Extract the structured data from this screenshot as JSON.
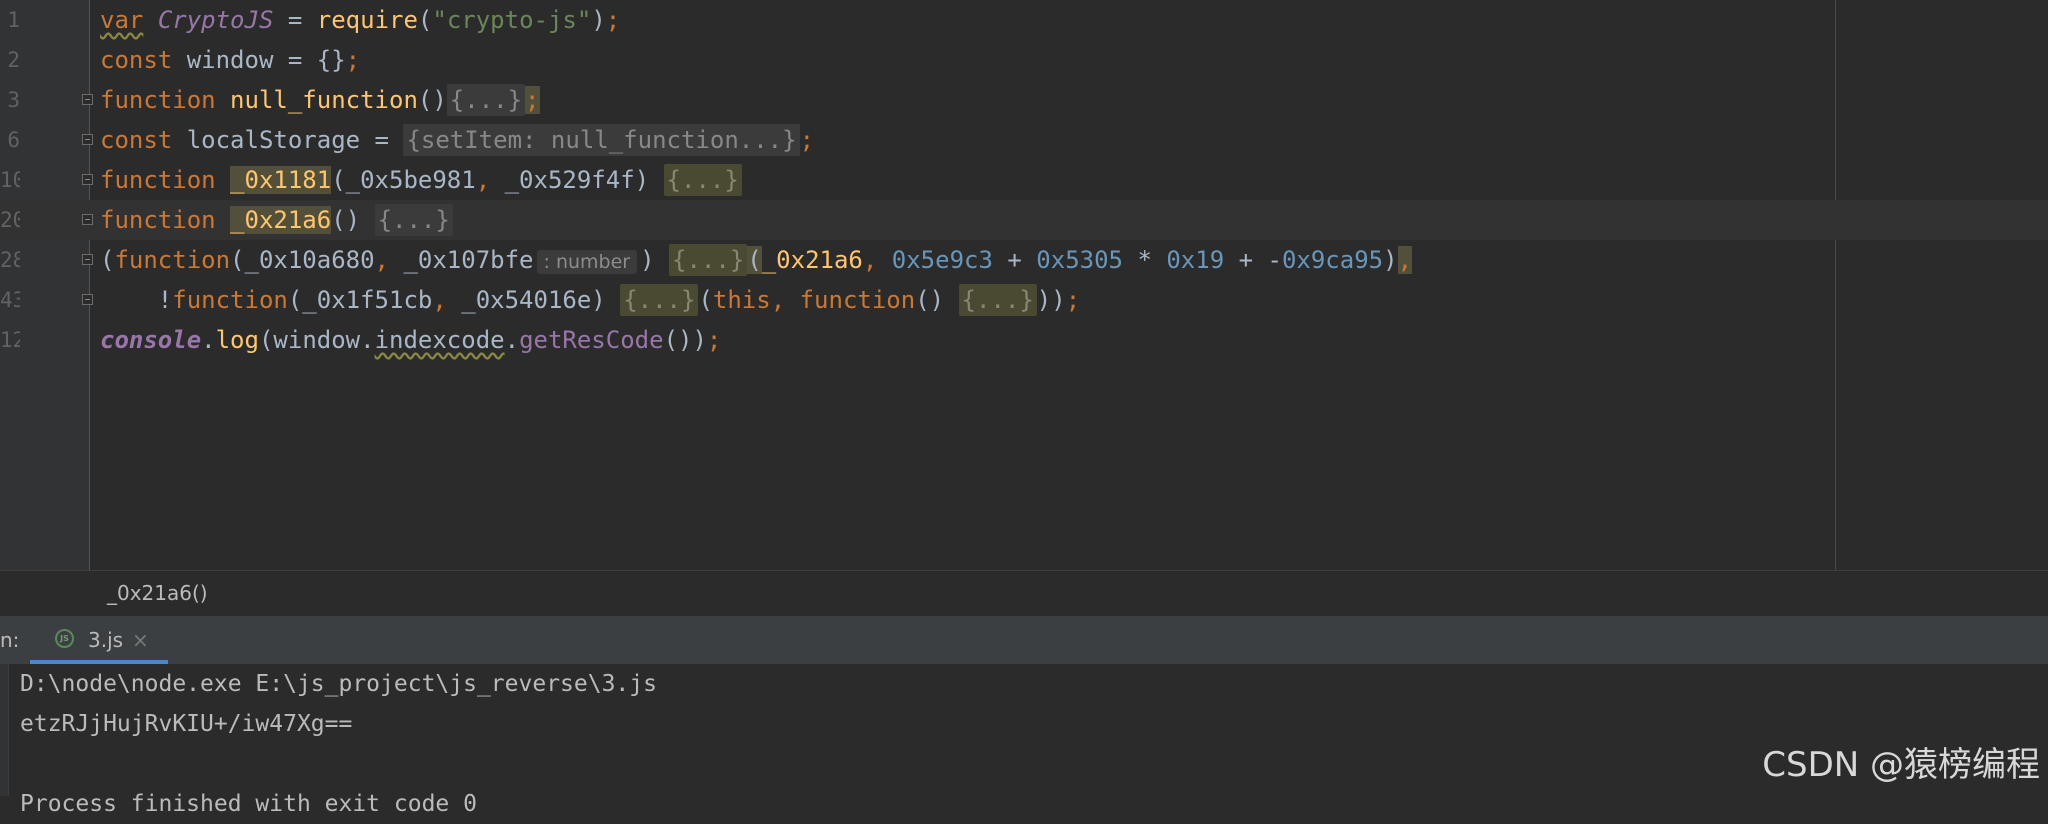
{
  "editor": {
    "line_numbers": [
      "1",
      "2",
      "3",
      "6",
      "10",
      "20",
      "28",
      "43",
      "12"
    ],
    "line1": {
      "kw_var": "var",
      "cryptojs": "CryptoJS",
      "eq": " = ",
      "require": "require",
      "open": "(",
      "str": "\"crypto-js\"",
      "close": ")",
      "semi": ";"
    },
    "line2": {
      "kw_const": "const",
      "rest": " window = {}",
      "semi": ";"
    },
    "line3": {
      "kw_function": "function",
      "name": "null_function",
      "paren": "()",
      "fold": "{...}",
      "semi": ";"
    },
    "line4": {
      "kw_const": "const",
      "rest": " localStorage = ",
      "fold": "{setItem: null_function...}",
      "semi": ";"
    },
    "line5": {
      "kw_function": "function",
      "name": "_0x1181",
      "open": "(_0x5be981",
      "comma": ",",
      "arg2": " _0x529f4f) ",
      "fold": "{...}"
    },
    "line6": {
      "kw_function": "function",
      "name": "_0x21a6",
      "paren": "() ",
      "fold": "{...}"
    },
    "line7": {
      "open": "(",
      "kw_function": "function",
      "args1": "(_0x10a680",
      "comma1": ",",
      "args2": " _0x107bfe",
      "hint": ": number",
      "close": ") ",
      "fold": "{...}",
      "call_open": "(",
      "arg_fn": "_0x21a6",
      "comma2": ", ",
      "n1": "0x5e9c3",
      "plus1": " + ",
      "n2": "0x5305",
      "mul": " * ",
      "n3": "0x19",
      "plus2": " + -",
      "n4": "0x9ca95",
      "call_close": ")",
      "comma3": ","
    },
    "line8": {
      "indent": "    !",
      "kw_function": "function",
      "args": "(_0x1f51cb",
      "comma1": ",",
      "args2": " _0x54016e) ",
      "fold1": "{...}",
      "open": "(",
      "kw_this": "this",
      "comma2": ", ",
      "kw_function2": "function",
      "paren": "() ",
      "fold2": "{...}",
      "close": "))",
      "semi": ";"
    },
    "line9": {
      "console": "console",
      "dot1": ".",
      "log": "log",
      "open": "(window.",
      "indexcode": "indexcode",
      "dot2": ".",
      "method": "getResCode",
      "close": "())",
      "semi": ";"
    }
  },
  "breadcrumb": {
    "text": "_0x21a6()"
  },
  "run_panel": {
    "label": "n:",
    "tab_label": "3.js",
    "tab_icon": "JS",
    "close_glyph": "×"
  },
  "console": {
    "lines": [
      "D:\\node\\node.exe E:\\js_project\\js_reverse\\3.js",
      "etzRJjHujRvKIU+/iw47Xg==",
      "",
      "Process finished with exit code 0"
    ]
  },
  "watermark": "CSDN @猿榜编程"
}
